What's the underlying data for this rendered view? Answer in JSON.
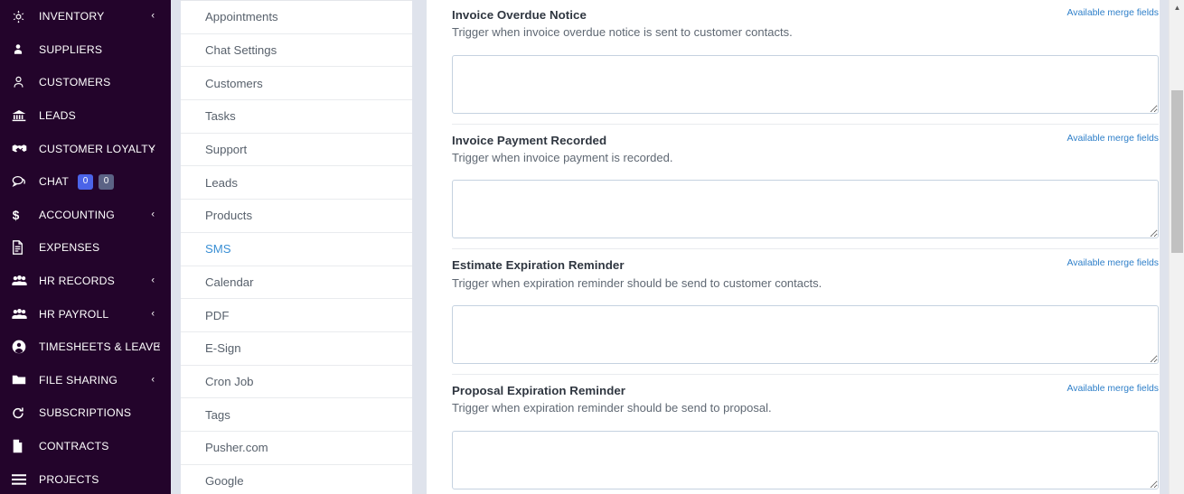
{
  "sidebar": {
    "background_color": "#23042b",
    "items": [
      {
        "label": "INVENTORY",
        "icon": "snowflake-icon",
        "caret": "‹",
        "has_caret": true
      },
      {
        "label": "SUPPLIERS",
        "icon": "user-filled-icon",
        "has_caret": false
      },
      {
        "label": "CUSTOMERS",
        "icon": "user-outline-icon",
        "has_caret": false
      },
      {
        "label": "LEADS",
        "icon": "bank-icon",
        "has_caret": false
      },
      {
        "label": "CUSTOMER LOYALTY",
        "icon": "handshake-icon",
        "caret": "‹",
        "has_caret": true
      },
      {
        "label": "CHAT",
        "icon": "chat-bubbles-icon",
        "has_caret": false,
        "badges": [
          {
            "value": "0",
            "color": "#4b64e8",
            "style": "primary"
          },
          {
            "value": "0",
            "color": "#5b6385",
            "style": "muted"
          }
        ]
      },
      {
        "label": "ACCOUNTING",
        "icon": "dollar-icon",
        "caret": "‹",
        "has_caret": true
      },
      {
        "label": "EXPENSES",
        "icon": "document-icon",
        "has_caret": false
      },
      {
        "label": "HR RECORDS",
        "icon": "people-group-icon",
        "caret": "‹",
        "has_caret": true
      },
      {
        "label": "HR PAYROLL",
        "icon": "people-group-icon",
        "caret": "‹",
        "has_caret": true
      },
      {
        "label": "TIMESHEETS & LEAVE",
        "icon": "user-circle-icon",
        "caret": "‹",
        "has_caret": true
      },
      {
        "label": "FILE SHARING",
        "icon": "folder-icon",
        "caret": "‹",
        "has_caret": true
      },
      {
        "label": "SUBSCRIPTIONS",
        "icon": "refresh-icon",
        "has_caret": false
      },
      {
        "label": "CONTRACTS",
        "icon": "file-icon",
        "has_caret": false
      },
      {
        "label": "PROJECTS",
        "icon": "list-lines-icon",
        "has_caret": false
      }
    ]
  },
  "settings_list": {
    "active_item": "SMS",
    "items": [
      {
        "label": "Appointments",
        "active": false
      },
      {
        "label": "Chat Settings",
        "active": false
      },
      {
        "label": "Customers",
        "active": false
      },
      {
        "label": "Tasks",
        "active": false
      },
      {
        "label": "Support",
        "active": false
      },
      {
        "label": "Leads",
        "active": false
      },
      {
        "label": "Products",
        "active": false
      },
      {
        "label": "SMS",
        "active": true
      },
      {
        "label": "Calendar",
        "active": false
      },
      {
        "label": "PDF",
        "active": false
      },
      {
        "label": "E-Sign",
        "active": false
      },
      {
        "label": "Cron Job",
        "active": false
      },
      {
        "label": "Tags",
        "active": false
      },
      {
        "label": "Pusher.com",
        "active": false
      },
      {
        "label": "Google",
        "active": false
      }
    ]
  },
  "main": {
    "merge_link_label": "Available merge fields",
    "triggers": [
      {
        "title": "Invoice Overdue Notice",
        "description": "Trigger when invoice overdue notice is sent to customer contacts.",
        "merge_link": "Available merge fields",
        "value": "",
        "placeholder": ""
      },
      {
        "title": "Invoice Payment Recorded",
        "description": "Trigger when invoice payment is recorded.",
        "merge_link": "Available merge fields",
        "value": "",
        "placeholder": ""
      },
      {
        "title": "Estimate Expiration Reminder",
        "description": "Trigger when expiration reminder should be send to customer contacts.",
        "merge_link": "Available merge fields",
        "value": "",
        "placeholder": ""
      },
      {
        "title": "Proposal Expiration Reminder",
        "description": "Trigger when expiration reminder should be send to proposal.",
        "merge_link": "Available merge fields",
        "value": "",
        "placeholder": ""
      }
    ]
  },
  "scrollbar": {
    "up_arrow": "▲",
    "down_arrow": "▼"
  },
  "colors": {
    "sidebar_bg": "#23042b",
    "page_bg": "#dfe3ec",
    "accent_link": "#2e7fc9",
    "active_list_item": "#3a8fd4",
    "badge_primary": "#4b64e8",
    "badge_muted": "#5b6385"
  }
}
